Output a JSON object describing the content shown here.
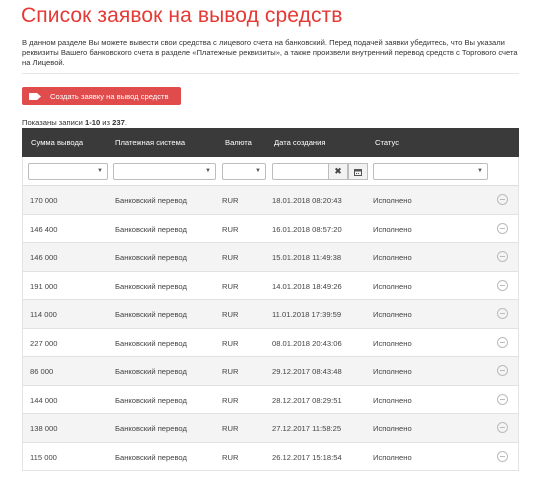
{
  "page": {
    "title": "Список заявок на вывод средств",
    "intro": "В данном разделе Вы можете вывести свои средства с лицевого счета на банковский. Перед подачей заявки убедитесь, что Вы указали реквизиты Вашего банковского счета в разделе «Платежные реквизиты», а также произвели внутренний перевод средств с Торгового счета на Лицевой."
  },
  "create_button": {
    "label": "Создать заявку на вывод средств",
    "icon": "tag-icon"
  },
  "records": {
    "prefix": "Показаны записи ",
    "range": "1-10",
    "middle": " из ",
    "total": "237",
    "suffix": "."
  },
  "columns": [
    "Сумма вывода",
    "Платежная система",
    "Валюта",
    "Дата создания",
    "Статус"
  ],
  "rows": [
    {
      "amount": "170 000",
      "system": "Банковский перевод",
      "currency": "RUR",
      "date": "18.01.2018 08:20:43",
      "status": "Исполнено"
    },
    {
      "amount": "146 400",
      "system": "Банковский перевод",
      "currency": "RUR",
      "date": "16.01.2018 08:57:20",
      "status": "Исполнено"
    },
    {
      "amount": "146 000",
      "system": "Банковский перевод",
      "currency": "RUR",
      "date": "15.01.2018 11:49:38",
      "status": "Исполнено"
    },
    {
      "amount": "191 000",
      "system": "Банковский перевод",
      "currency": "RUR",
      "date": "14.01.2018 18:49:26",
      "status": "Исполнено"
    },
    {
      "amount": "114 000",
      "system": "Банковский перевод",
      "currency": "RUR",
      "date": "11.01.2018 17:39:59",
      "status": "Исполнено"
    },
    {
      "amount": "227 000",
      "system": "Банковский перевод",
      "currency": "RUR",
      "date": "08.01.2018 20:43:06",
      "status": "Исполнено"
    },
    {
      "amount": "86 000",
      "system": "Банковский перевод",
      "currency": "RUR",
      "date": "29.12.2017 08:43:48",
      "status": "Исполнено"
    },
    {
      "amount": "144 000",
      "system": "Банковский перевод",
      "currency": "RUR",
      "date": "28.12.2017 08:29:51",
      "status": "Исполнено"
    },
    {
      "amount": "138 000",
      "system": "Банковский перевод",
      "currency": "RUR",
      "date": "27.12.2017 11:58:25",
      "status": "Исполнено"
    },
    {
      "amount": "115 000",
      "system": "Банковский перевод",
      "currency": "RUR",
      "date": "26.12.2017 15:18:54",
      "status": "Исполнено"
    }
  ],
  "colors": {
    "accent": "#e53935",
    "button": "#e04b4b",
    "header": "#3a3a3a"
  }
}
